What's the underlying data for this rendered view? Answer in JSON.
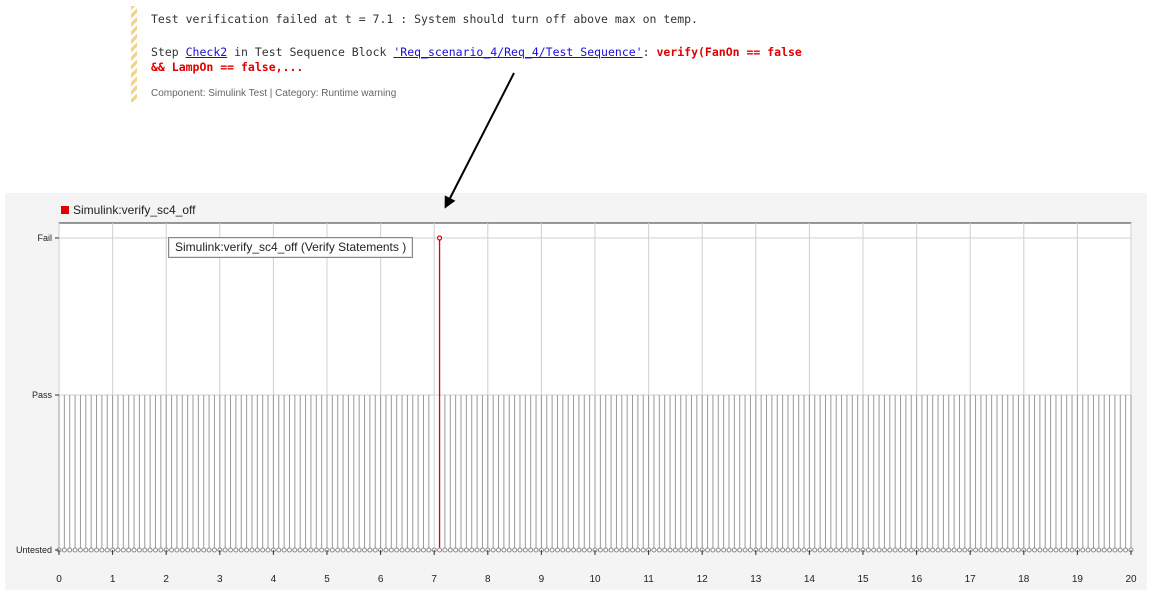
{
  "message": {
    "line1": "Test verification failed at t = 7.1 : System should turn off above max on temp.",
    "line2_prefix": "Step ",
    "step_link": "Check2",
    "line2_mid": " in Test Sequence Block ",
    "block_link": "'Req_scenario_4/Req_4/Test Sequence'",
    "line2_colon": ": ",
    "verify_line1": "verify(FanOn == false",
    "verify_line2": "&& LampOn == false,...",
    "component": "Component: Simulink Test | Category: Runtime warning"
  },
  "plot": {
    "legend_label": "Simulink:verify_sc4_off",
    "legend_color": "#e00000",
    "tooltip": "Simulink:verify_sc4_off (Verify Statements )"
  },
  "chart_data": {
    "type": "stem",
    "xlim": [
      0,
      20
    ],
    "x_ticks": [
      0,
      1,
      2,
      3,
      4,
      5,
      6,
      7,
      8,
      9,
      10,
      11,
      12,
      13,
      14,
      15,
      16,
      17,
      18,
      19,
      20
    ],
    "y_categories": [
      "Untested",
      "Pass",
      "Fail"
    ],
    "sample_step": 0.1,
    "grid": true,
    "series": [
      {
        "name": "Simulink:verify_sc4_off",
        "default_level": "Pass",
        "exceptions": [
          {
            "x": 7.0,
            "level": "Untested"
          },
          {
            "x": 7.1,
            "level": "Fail"
          }
        ],
        "pass_color": "#9a9a9a",
        "fail_color": "#e00000"
      }
    ]
  }
}
